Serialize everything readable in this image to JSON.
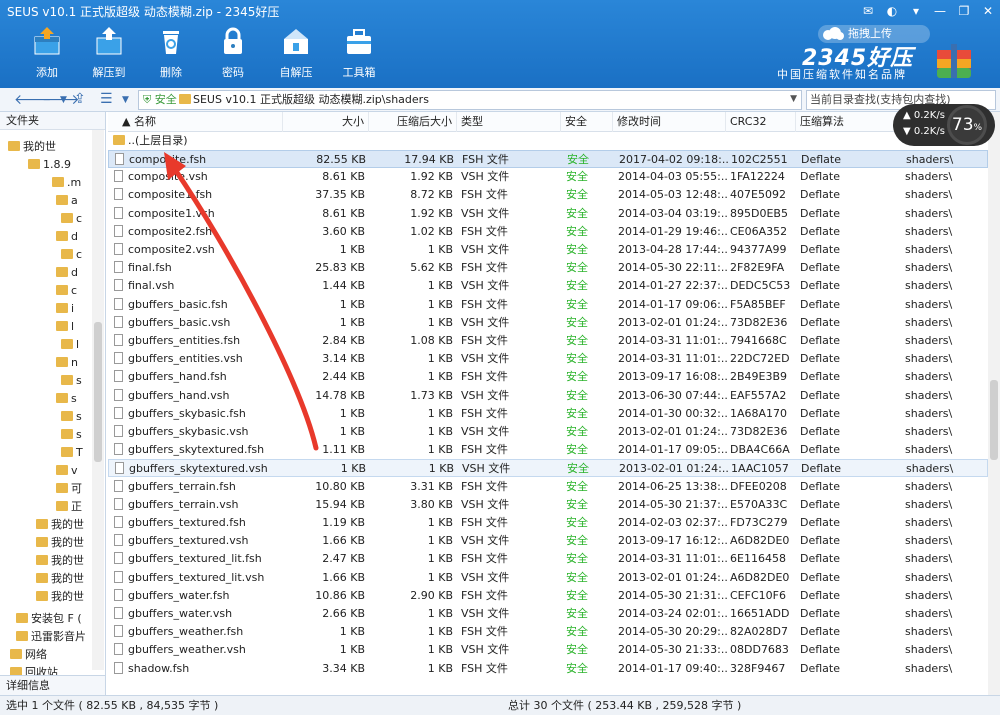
{
  "title": "SEUS v10.1 正式版超级 动态模糊.zip - 2345好压",
  "toolbar": [
    {
      "label": "添加",
      "icon": "add-icon"
    },
    {
      "label": "解压到",
      "icon": "extract-icon"
    },
    {
      "label": "删除",
      "icon": "delete-icon"
    },
    {
      "label": "密码",
      "icon": "lock-icon"
    },
    {
      "label": "自解压",
      "icon": "self-extract-icon"
    },
    {
      "label": "工具箱",
      "icon": "toolbox-icon"
    }
  ],
  "upload_label": "拖拽上传",
  "brand": "2345好压",
  "slogan": "中国压缩软件知名品牌",
  "safe_label": "安全",
  "path": "SEUS v10.1 正式版超级 动态模糊.zip\\shaders",
  "search_placeholder": "当前目录查找(支持包内查找)",
  "left": {
    "header": "文件夹",
    "footer": "详细信息",
    "items": [
      "我的世",
      "1.8.9",
      ".m",
      "a",
      "c",
      "d",
      "c",
      "d",
      "c",
      "i",
      "l",
      "l",
      "n",
      "s",
      "s",
      "s",
      "s",
      "T",
      "v",
      "可",
      "正",
      "我的世",
      "我的世",
      "我的世",
      "我的世",
      "我的世",
      "安装包 F (",
      "迅雷影音片",
      "网络",
      "回收站"
    ]
  },
  "columns": [
    "名称",
    "大小",
    "压缩后大小",
    "类型",
    "安全",
    "修改时间",
    "CRC32",
    "压缩算法"
  ],
  "parent_row": "..(上层目录)",
  "files": [
    {
      "name": "composite.fsh",
      "size": "82.55 KB",
      "packed": "17.94 KB",
      "type": "FSH 文件",
      "safe": "安全",
      "time": "2017-04-02 09:18:...",
      "crc": "102C2551",
      "method": "Deflate",
      "path": "shaders\\"
    },
    {
      "name": "composite.vsh",
      "size": "8.61 KB",
      "packed": "1.92 KB",
      "type": "VSH 文件",
      "safe": "安全",
      "time": "2014-04-03 05:55:...",
      "crc": "1FA12224",
      "method": "Deflate",
      "path": "shaders\\"
    },
    {
      "name": "composite1.fsh",
      "size": "37.35 KB",
      "packed": "8.72 KB",
      "type": "FSH 文件",
      "safe": "安全",
      "time": "2014-05-03 12:48:...",
      "crc": "407E5092",
      "method": "Deflate",
      "path": "shaders\\"
    },
    {
      "name": "composite1.vsh",
      "size": "8.61 KB",
      "packed": "1.92 KB",
      "type": "VSH 文件",
      "safe": "安全",
      "time": "2014-03-04 03:19:...",
      "crc": "895D0EB5",
      "method": "Deflate",
      "path": "shaders\\"
    },
    {
      "name": "composite2.fsh",
      "size": "3.60 KB",
      "packed": "1.02 KB",
      "type": "FSH 文件",
      "safe": "安全",
      "time": "2014-01-29 19:46:...",
      "crc": "CE06A352",
      "method": "Deflate",
      "path": "shaders\\"
    },
    {
      "name": "composite2.vsh",
      "size": "1 KB",
      "packed": "1 KB",
      "type": "VSH 文件",
      "safe": "安全",
      "time": "2013-04-28 17:44:...",
      "crc": "94377A99",
      "method": "Deflate",
      "path": "shaders\\"
    },
    {
      "name": "final.fsh",
      "size": "25.83 KB",
      "packed": "5.62 KB",
      "type": "FSH 文件",
      "safe": "安全",
      "time": "2014-05-30 22:11:...",
      "crc": "2F82E9FA",
      "method": "Deflate",
      "path": "shaders\\"
    },
    {
      "name": "final.vsh",
      "size": "1.44 KB",
      "packed": "1 KB",
      "type": "VSH 文件",
      "safe": "安全",
      "time": "2014-01-27 22:37:...",
      "crc": "DEDC5C53",
      "method": "Deflate",
      "path": "shaders\\"
    },
    {
      "name": "gbuffers_basic.fsh",
      "size": "1 KB",
      "packed": "1 KB",
      "type": "FSH 文件",
      "safe": "安全",
      "time": "2014-01-17 09:06:...",
      "crc": "F5A85BEF",
      "method": "Deflate",
      "path": "shaders\\"
    },
    {
      "name": "gbuffers_basic.vsh",
      "size": "1 KB",
      "packed": "1 KB",
      "type": "VSH 文件",
      "safe": "安全",
      "time": "2013-02-01 01:24:...",
      "crc": "73D82E36",
      "method": "Deflate",
      "path": "shaders\\"
    },
    {
      "name": "gbuffers_entities.fsh",
      "size": "2.84 KB",
      "packed": "1.08 KB",
      "type": "FSH 文件",
      "safe": "安全",
      "time": "2014-03-31 11:01:...",
      "crc": "7941668C",
      "method": "Deflate",
      "path": "shaders\\"
    },
    {
      "name": "gbuffers_entities.vsh",
      "size": "3.14 KB",
      "packed": "1 KB",
      "type": "VSH 文件",
      "safe": "安全",
      "time": "2014-03-31 11:01:...",
      "crc": "22DC72ED",
      "method": "Deflate",
      "path": "shaders\\"
    },
    {
      "name": "gbuffers_hand.fsh",
      "size": "2.44 KB",
      "packed": "1 KB",
      "type": "FSH 文件",
      "safe": "安全",
      "time": "2013-09-17 16:08:...",
      "crc": "2B49E3B9",
      "method": "Deflate",
      "path": "shaders\\"
    },
    {
      "name": "gbuffers_hand.vsh",
      "size": "14.78 KB",
      "packed": "1.73 KB",
      "type": "VSH 文件",
      "safe": "安全",
      "time": "2013-06-30 07:44:...",
      "crc": "EAF557A2",
      "method": "Deflate",
      "path": "shaders\\"
    },
    {
      "name": "gbuffers_skybasic.fsh",
      "size": "1 KB",
      "packed": "1 KB",
      "type": "FSH 文件",
      "safe": "安全",
      "time": "2014-01-30 00:32:...",
      "crc": "1A68A170",
      "method": "Deflate",
      "path": "shaders\\"
    },
    {
      "name": "gbuffers_skybasic.vsh",
      "size": "1 KB",
      "packed": "1 KB",
      "type": "VSH 文件",
      "safe": "安全",
      "time": "2013-02-01 01:24:...",
      "crc": "73D82E36",
      "method": "Deflate",
      "path": "shaders\\"
    },
    {
      "name": "gbuffers_skytextured.fsh",
      "size": "1.11 KB",
      "packed": "1 KB",
      "type": "FSH 文件",
      "safe": "安全",
      "time": "2014-01-17 09:05:...",
      "crc": "DBA4C66A",
      "method": "Deflate",
      "path": "shaders\\"
    },
    {
      "name": "gbuffers_skytextured.vsh",
      "size": "1 KB",
      "packed": "1 KB",
      "type": "VSH 文件",
      "safe": "安全",
      "time": "2013-02-01 01:24:...",
      "crc": "1AAC1057",
      "method": "Deflate",
      "path": "shaders\\"
    },
    {
      "name": "gbuffers_terrain.fsh",
      "size": "10.80 KB",
      "packed": "3.31 KB",
      "type": "FSH 文件",
      "safe": "安全",
      "time": "2014-06-25 13:38:...",
      "crc": "DFEE0208",
      "method": "Deflate",
      "path": "shaders\\"
    },
    {
      "name": "gbuffers_terrain.vsh",
      "size": "15.94 KB",
      "packed": "3.80 KB",
      "type": "VSH 文件",
      "safe": "安全",
      "time": "2014-05-30 21:37:...",
      "crc": "E570A33C",
      "method": "Deflate",
      "path": "shaders\\"
    },
    {
      "name": "gbuffers_textured.fsh",
      "size": "1.19 KB",
      "packed": "1 KB",
      "type": "FSH 文件",
      "safe": "安全",
      "time": "2014-02-03 02:37:...",
      "crc": "FD73C279",
      "method": "Deflate",
      "path": "shaders\\"
    },
    {
      "name": "gbuffers_textured.vsh",
      "size": "1.66 KB",
      "packed": "1 KB",
      "type": "VSH 文件",
      "safe": "安全",
      "time": "2013-09-17 16:12:...",
      "crc": "A6D82DE0",
      "method": "Deflate",
      "path": "shaders\\"
    },
    {
      "name": "gbuffers_textured_lit.fsh",
      "size": "2.47 KB",
      "packed": "1 KB",
      "type": "FSH 文件",
      "safe": "安全",
      "time": "2014-03-31 11:01:...",
      "crc": "6E116458",
      "method": "Deflate",
      "path": "shaders\\"
    },
    {
      "name": "gbuffers_textured_lit.vsh",
      "size": "1.66 KB",
      "packed": "1 KB",
      "type": "VSH 文件",
      "safe": "安全",
      "time": "2013-02-01 01:24:...",
      "crc": "A6D82DE0",
      "method": "Deflate",
      "path": "shaders\\"
    },
    {
      "name": "gbuffers_water.fsh",
      "size": "10.86 KB",
      "packed": "2.90 KB",
      "type": "FSH 文件",
      "safe": "安全",
      "time": "2014-05-30 21:31:...",
      "crc": "CEFC10F6",
      "method": "Deflate",
      "path": "shaders\\"
    },
    {
      "name": "gbuffers_water.vsh",
      "size": "2.66 KB",
      "packed": "1 KB",
      "type": "VSH 文件",
      "safe": "安全",
      "time": "2014-03-24 02:01:...",
      "crc": "16651ADD",
      "method": "Deflate",
      "path": "shaders\\"
    },
    {
      "name": "gbuffers_weather.fsh",
      "size": "1 KB",
      "packed": "1 KB",
      "type": "FSH 文件",
      "safe": "安全",
      "time": "2014-05-30 20:29:...",
      "crc": "82A028D7",
      "method": "Deflate",
      "path": "shaders\\"
    },
    {
      "name": "gbuffers_weather.vsh",
      "size": "1 KB",
      "packed": "1 KB",
      "type": "VSH 文件",
      "safe": "安全",
      "time": "2014-05-30 21:33:...",
      "crc": "08DD7683",
      "method": "Deflate",
      "path": "shaders\\"
    },
    {
      "name": "shadow.fsh",
      "size": "3.34 KB",
      "packed": "1 KB",
      "type": "FSH 文件",
      "safe": "安全",
      "time": "2014-01-17 09:40:...",
      "crc": "328F9467",
      "method": "Deflate",
      "path": "shaders\\"
    }
  ],
  "status": {
    "left": "选中 1 个文件 ( 82.55 KB , 84,535 字节 )",
    "right": "总计 30 个文件 ( 253.44 KB , 259,528 字节 )"
  },
  "net": {
    "up": "0.2K/s",
    "down": "0.2K/s",
    "percent": "73",
    "percent_sign": "%"
  },
  "colors": {
    "title_bg": "#1a70c4",
    "safe_green": "#2bb32b",
    "arrow": "#e8392b"
  }
}
